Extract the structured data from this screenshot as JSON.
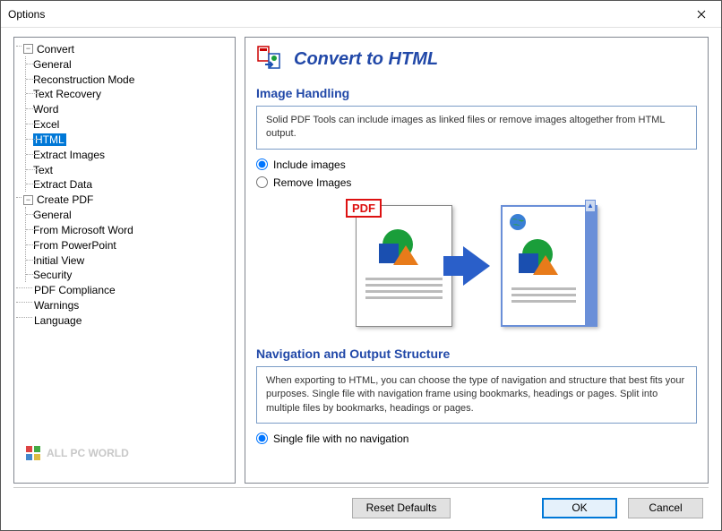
{
  "window": {
    "title": "Options"
  },
  "tree": {
    "convert": {
      "label": "Convert",
      "items": [
        "General",
        "Reconstruction Mode",
        "Text Recovery",
        "Word",
        "Excel",
        "HTML",
        "Extract Images",
        "Text",
        "Extract Data"
      ],
      "selected_index": 5
    },
    "create_pdf": {
      "label": "Create PDF",
      "items": [
        "General",
        "From Microsoft Word",
        "From PowerPoint",
        "Initial View",
        "Security"
      ]
    },
    "others": [
      "PDF Compliance",
      "Warnings",
      "Language"
    ]
  },
  "content": {
    "header_title": "Convert to HTML",
    "section1": {
      "title": "Image Handling",
      "info": "Solid PDF Tools can include images as linked files or remove images altogether from HTML output.",
      "radio1": "Include images",
      "radio2": "Remove Images",
      "pdf_badge": "PDF"
    },
    "section2": {
      "title": "Navigation and Output Structure",
      "info": "When exporting to HTML, you can choose the type of navigation and structure that best fits your purposes. Single file with navigation frame using bookmarks, headings or pages. Split into multiple files by bookmarks, headings or pages.",
      "radio1": "Single file with no navigation"
    }
  },
  "buttons": {
    "reset": "Reset Defaults",
    "ok": "OK",
    "cancel": "Cancel"
  },
  "watermark": {
    "text": "ALL PC WORLD"
  }
}
